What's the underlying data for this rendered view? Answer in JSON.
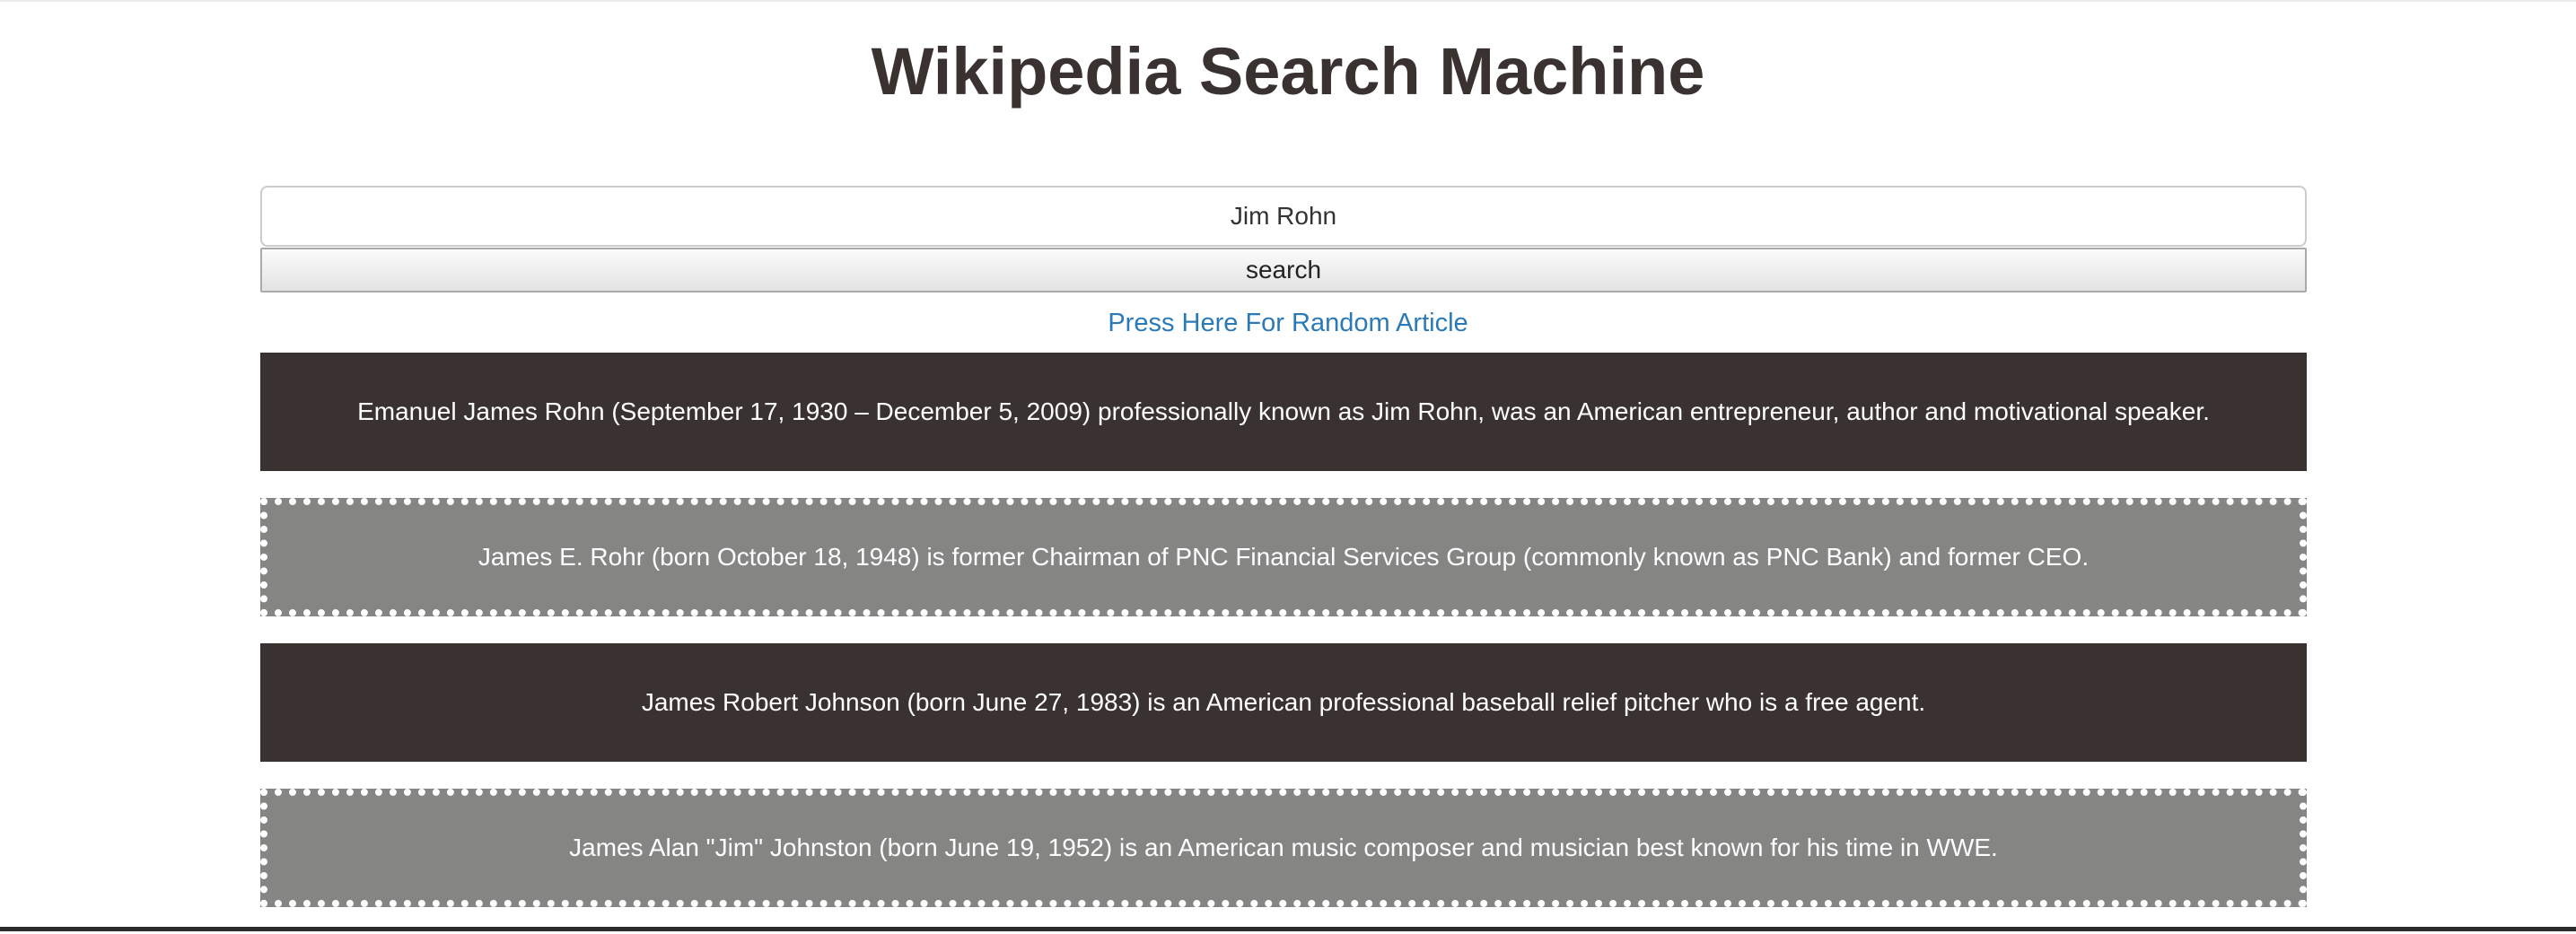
{
  "page": {
    "title": "Wikipedia Search Machine"
  },
  "search": {
    "query": "Jim Rohn",
    "button_label": "search"
  },
  "random_link": {
    "label": "Press Here For Random Article"
  },
  "results": [
    {
      "text": "Emanuel James Rohn (September 17, 1930 – December 5, 2009) professionally known as Jim Rohn, was an American entrepreneur, author and motivational speaker.",
      "style": "dark"
    },
    {
      "text": "James E. Rohr (born October 18, 1948) is former Chairman of PNC Financial Services Group (commonly known as PNC Bank) and former CEO.",
      "style": "light"
    },
    {
      "text": "James Robert Johnson (born June 27, 1983) is an American professional baseball relief pitcher who is a free agent.",
      "style": "dark"
    },
    {
      "text": "James Alan \"Jim\" Johnston (born June 19, 1952) is an American music composer and musician best known for his time in WWE.",
      "style": "light"
    }
  ],
  "colors": {
    "title": "#3a3131",
    "dark_card": "#3a3131",
    "light_card": "#858584",
    "link": "#2a7ab8"
  }
}
